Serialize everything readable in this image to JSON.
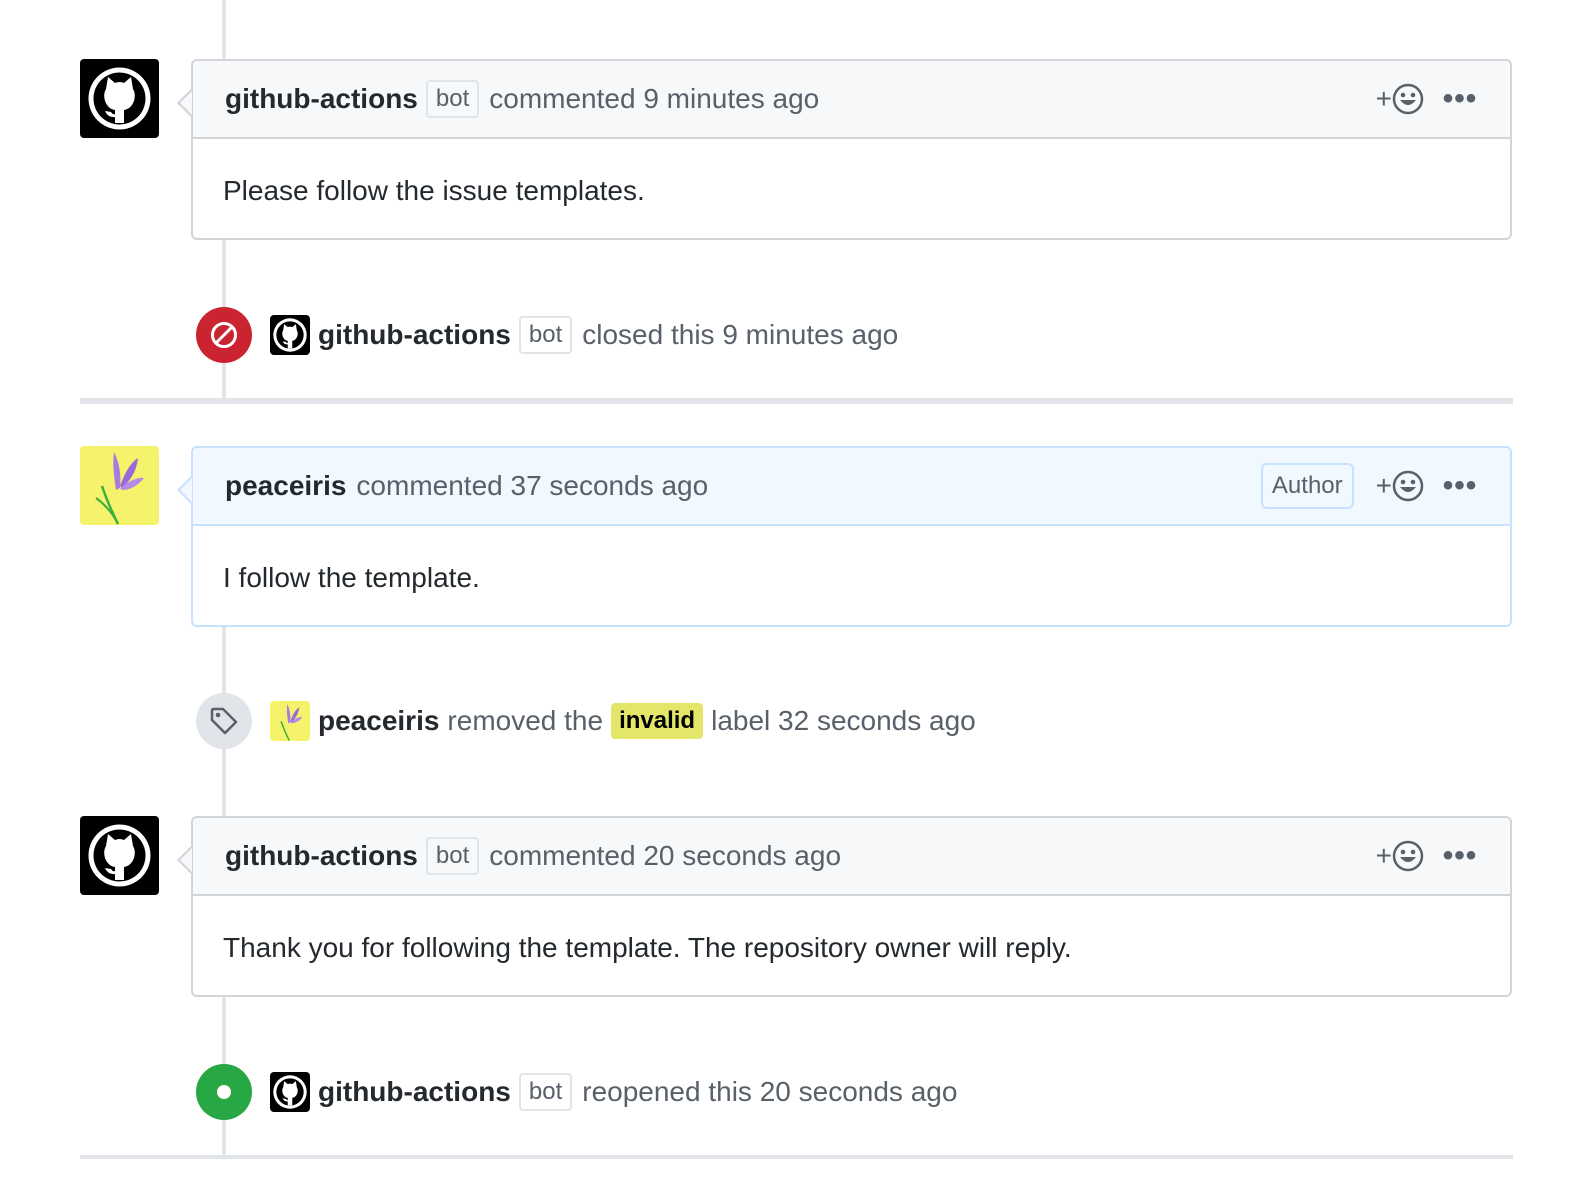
{
  "timeline": [
    {
      "type": "comment",
      "author": "github-actions",
      "bot_badge": "bot",
      "meta": "commented 9 minutes ago",
      "body": "Please follow the issue templates.",
      "react_plus": "+",
      "more_label": "•••"
    },
    {
      "type": "event",
      "event": "closed",
      "icon": "circle-slash-icon",
      "icon_color": "#cb2431",
      "actor": "github-actions",
      "bot_badge": "bot",
      "text": "closed this 9 minutes ago"
    },
    {
      "type": "comment",
      "author": "peaceiris",
      "meta": "commented 37 seconds ago",
      "author_badge": "Author",
      "body": "I follow the template.",
      "react_plus": "+",
      "more_label": "•••"
    },
    {
      "type": "event",
      "event": "unlabeled",
      "icon": "tag-icon",
      "actor": "peaceiris",
      "text_before": "removed the",
      "label": "invalid",
      "label_color": "#e4e669",
      "text_after": "label 32 seconds ago"
    },
    {
      "type": "comment",
      "author": "github-actions",
      "bot_badge": "bot",
      "meta": "commented 20 seconds ago",
      "body": "Thank you for following the template. The repository owner will reply.",
      "react_plus": "+",
      "more_label": "•••"
    },
    {
      "type": "event",
      "event": "reopened",
      "icon": "dot-fill-icon",
      "icon_color": "#28a745",
      "actor": "github-actions",
      "bot_badge": "bot",
      "text": "reopened this 20 seconds ago"
    }
  ]
}
